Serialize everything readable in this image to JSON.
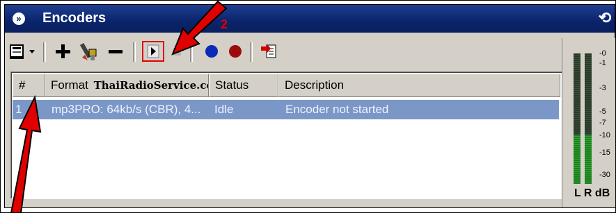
{
  "window": {
    "title": "Encoders",
    "annotation_number": "2"
  },
  "toolbar": {
    "items": [
      "encoder-menu-icon",
      "dropdown-arrow-icon",
      "add-icon",
      "configure-icon",
      "remove-icon",
      "start-icon",
      "stop-icon",
      "blue-record-icon",
      "red-record-icon",
      "export-icon"
    ],
    "colors": {
      "start_highlight": "#e00000",
      "blue": "#0b2bb5",
      "red": "#9c0c0c"
    }
  },
  "list": {
    "columns": [
      {
        "label": "#"
      },
      {
        "label": "Format",
        "watermark": "ThaiRadioService.com"
      },
      {
        "label": "Status"
      },
      {
        "label": "Description"
      }
    ],
    "rows": [
      {
        "num": "1",
        "format": "mp3PRO: 64kb/s (CBR), 4...",
        "status": "Idle",
        "description": "Encoder not started"
      }
    ],
    "selected_color": "#7b97c7"
  },
  "meter": {
    "ticks": [
      "-0",
      "-1",
      "-3",
      "-5",
      "-7",
      "-10",
      "-15",
      "-30"
    ],
    "label": "L R dB"
  },
  "annotations": {
    "arrow_color": "#e00000"
  }
}
